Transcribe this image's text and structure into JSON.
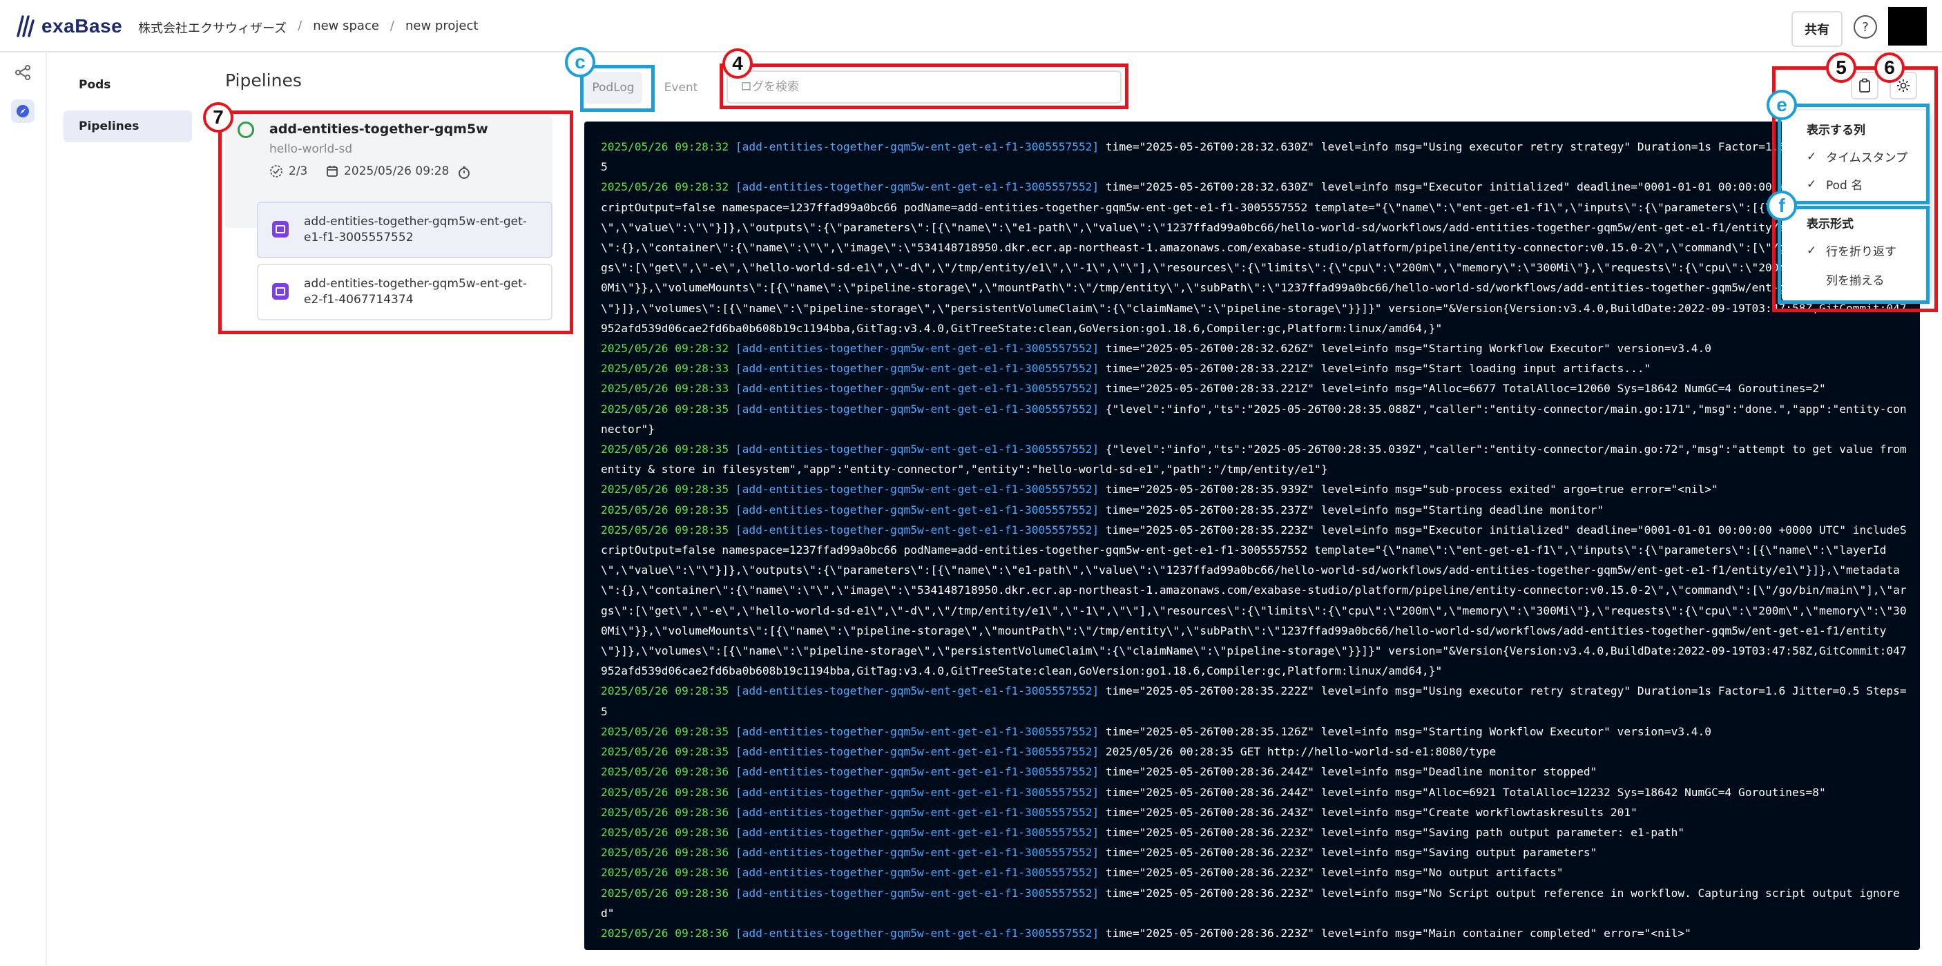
{
  "header": {
    "brand": "exaBase",
    "breadcrumbs": [
      "株式会社エクサウィザーズ",
      "new space",
      "new project"
    ],
    "separator": "/",
    "share_label": "共有",
    "help_symbol": "?"
  },
  "nav": {
    "items": [
      {
        "label": "Pods",
        "active": false
      },
      {
        "label": "Pipelines",
        "active": true
      }
    ]
  },
  "pipelines": {
    "title": "Pipelines",
    "card": {
      "name": "add-entities-together-gqm5w",
      "subtitle": "hello-world-sd",
      "progress": "2/3",
      "date": "2025/05/26 09:28",
      "status": "running"
    },
    "sub_items": [
      "add-entities-together-gqm5w-ent-get-e1-f1-3005557552",
      "add-entities-together-gqm5w-ent-get-e2-f1-4067714374"
    ]
  },
  "log_view": {
    "tabs": [
      {
        "label": "PodLog",
        "active": true
      },
      {
        "label": "Event",
        "active": false
      }
    ],
    "search_placeholder": "ログを検索",
    "lines": [
      {
        "ts": "2025/05/26 09:28:32",
        "pod": "[add-entities-together-gqm5w-ent-get-e1-f1-3005557552]",
        "msg": " time=\"2025-05-26T00:28:32.630Z\" level=info msg=\"Using executor retry strategy\" Duration=1s Factor=1.6 Jitter=0.5 Steps=5"
      },
      {
        "ts": "2025/05/26 09:28:32",
        "pod": "[add-entities-together-gqm5w-ent-get-e1-f1-3005557552]",
        "msg": " time=\"2025-05-26T00:28:32.630Z\" level=info msg=\"Executor initialized\" deadline=\"0001-01-01 00:00:00 +0000 UTC\" includeScriptOutput=false namespace=1237ffad99a0bc66 podName=add-entities-together-gqm5w-ent-get-e1-f1-3005557552 template=\"{\\\"name\\\":\\\"ent-get-e1-f1\\\",\\\"inputs\\\":{\\\"parameters\\\":[{\\\"name\\\":\\\"layerId\\\",\\\"value\\\":\\\"\\\"}]},\\\"outputs\\\":{\\\"parameters\\\":[{\\\"name\\\":\\\"e1-path\\\",\\\"value\\\":\\\"1237ffad99a0bc66/hello-world-sd/workflows/add-entities-together-gqm5w/ent-get-e1-f1/entity/e1\\\"}]},\\\"metadata\\\":{},\\\"container\\\":{\\\"name\\\":\\\"\\\",\\\"image\\\":\\\"534148718950.dkr.ecr.ap-northeast-1.amazonaws.com/exabase-studio/platform/pipeline/entity-connector:v0.15.0-2\\\",\\\"command\\\":[\\\"/go/bin/main\\\"],\\\"args\\\":[\\\"get\\\",\\\"-e\\\",\\\"hello-world-sd-e1\\\",\\\"-d\\\",\\\"/tmp/entity/e1\\\",\\\"-1\\\",\\\"\\\"],\\\"resources\\\":{\\\"limits\\\":{\\\"cpu\\\":\\\"200m\\\",\\\"memory\\\":\\\"300Mi\\\"},\\\"requests\\\":{\\\"cpu\\\":\\\"200m\\\",\\\"memory\\\":\\\"300Mi\\\"}},\\\"volumeMounts\\\":[{\\\"name\\\":\\\"pipeline-storage\\\",\\\"mountPath\\\":\\\"/tmp/entity\\\",\\\"subPath\\\":\\\"1237ffad99a0bc66/hello-world-sd/workflows/add-entities-together-gqm5w/ent-get-e1-f1/entity\\\"}]},\\\"volumes\\\":[{\\\"name\\\":\\\"pipeline-storage\\\",\\\"persistentVolumeClaim\\\":{\\\"claimName\\\":\\\"pipeline-storage\\\"}}]}\" version=\"&Version{Version:v3.4.0,BuildDate:2022-09-19T03:47:58Z,GitCommit:047952afd539d06cae2fd6ba0b608b19c1194bba,GitTag:v3.4.0,GitTreeState:clean,GoVersion:go1.18.6,Compiler:gc,Platform:linux/amd64,}\""
      },
      {
        "ts": "2025/05/26 09:28:32",
        "pod": "[add-entities-together-gqm5w-ent-get-e1-f1-3005557552]",
        "msg": " time=\"2025-05-26T00:28:32.626Z\" level=info msg=\"Starting Workflow Executor\" version=v3.4.0"
      },
      {
        "ts": "2025/05/26 09:28:33",
        "pod": "[add-entities-together-gqm5w-ent-get-e1-f1-3005557552]",
        "msg": " time=\"2025-05-26T00:28:33.221Z\" level=info msg=\"Start loading input artifacts...\""
      },
      {
        "ts": "2025/05/26 09:28:33",
        "pod": "[add-entities-together-gqm5w-ent-get-e1-f1-3005557552]",
        "msg": " time=\"2025-05-26T00:28:33.221Z\" level=info msg=\"Alloc=6677 TotalAlloc=12060 Sys=18642 NumGC=4 Goroutines=2\""
      },
      {
        "ts": "2025/05/26 09:28:35",
        "pod": "[add-entities-together-gqm5w-ent-get-e1-f1-3005557552]",
        "msg": " {\"level\":\"info\",\"ts\":\"2025-05-26T00:28:35.088Z\",\"caller\":\"entity-connector/main.go:171\",\"msg\":\"done.\",\"app\":\"entity-connector\"}"
      },
      {
        "ts": "2025/05/26 09:28:35",
        "pod": "[add-entities-together-gqm5w-ent-get-e1-f1-3005557552]",
        "msg": " {\"level\":\"info\",\"ts\":\"2025-05-26T00:28:35.039Z\",\"caller\":\"entity-connector/main.go:72\",\"msg\":\"attempt to get value from entity & store in filesystem\",\"app\":\"entity-connector\",\"entity\":\"hello-world-sd-e1\",\"path\":\"/tmp/entity/e1\"}"
      },
      {
        "ts": "2025/05/26 09:28:35",
        "pod": "[add-entities-together-gqm5w-ent-get-e1-f1-3005557552]",
        "msg": " time=\"2025-05-26T00:28:35.939Z\" level=info msg=\"sub-process exited\" argo=true error=\"<nil>\""
      },
      {
        "ts": "2025/05/26 09:28:35",
        "pod": "[add-entities-together-gqm5w-ent-get-e1-f1-3005557552]",
        "msg": " time=\"2025-05-26T00:28:35.237Z\" level=info msg=\"Starting deadline monitor\""
      },
      {
        "ts": "2025/05/26 09:28:35",
        "pod": "[add-entities-together-gqm5w-ent-get-e1-f1-3005557552]",
        "msg": " time=\"2025-05-26T00:28:35.223Z\" level=info msg=\"Executor initialized\" deadline=\"0001-01-01 00:00:00 +0000 UTC\" includeScriptOutput=false namespace=1237ffad99a0bc66 podName=add-entities-together-gqm5w-ent-get-e1-f1-3005557552 template=\"{\\\"name\\\":\\\"ent-get-e1-f1\\\",\\\"inputs\\\":{\\\"parameters\\\":[{\\\"name\\\":\\\"layerId\\\",\\\"value\\\":\\\"\\\"}]},\\\"outputs\\\":{\\\"parameters\\\":[{\\\"name\\\":\\\"e1-path\\\",\\\"value\\\":\\\"1237ffad99a0bc66/hello-world-sd/workflows/add-entities-together-gqm5w/ent-get-e1-f1/entity/e1\\\"}]},\\\"metadata\\\":{},\\\"container\\\":{\\\"name\\\":\\\"\\\",\\\"image\\\":\\\"534148718950.dkr.ecr.ap-northeast-1.amazonaws.com/exabase-studio/platform/pipeline/entity-connector:v0.15.0-2\\\",\\\"command\\\":[\\\"/go/bin/main\\\"],\\\"args\\\":[\\\"get\\\",\\\"-e\\\",\\\"hello-world-sd-e1\\\",\\\"-d\\\",\\\"/tmp/entity/e1\\\",\\\"-1\\\",\\\"\\\"],\\\"resources\\\":{\\\"limits\\\":{\\\"cpu\\\":\\\"200m\\\",\\\"memory\\\":\\\"300Mi\\\"},\\\"requests\\\":{\\\"cpu\\\":\\\"200m\\\",\\\"memory\\\":\\\"300Mi\\\"}},\\\"volumeMounts\\\":[{\\\"name\\\":\\\"pipeline-storage\\\",\\\"mountPath\\\":\\\"/tmp/entity\\\",\\\"subPath\\\":\\\"1237ffad99a0bc66/hello-world-sd/workflows/add-entities-together-gqm5w/ent-get-e1-f1/entity\\\"}]},\\\"volumes\\\":[{\\\"name\\\":\\\"pipeline-storage\\\",\\\"persistentVolumeClaim\\\":{\\\"claimName\\\":\\\"pipeline-storage\\\"}}]}\" version=\"&Version{Version:v3.4.0,BuildDate:2022-09-19T03:47:58Z,GitCommit:047952afd539d06cae2fd6ba0b608b19c1194bba,GitTag:v3.4.0,GitTreeState:clean,GoVersion:go1.18.6,Compiler:gc,Platform:linux/amd64,}\""
      },
      {
        "ts": "2025/05/26 09:28:35",
        "pod": "[add-entities-together-gqm5w-ent-get-e1-f1-3005557552]",
        "msg": " time=\"2025-05-26T00:28:35.222Z\" level=info msg=\"Using executor retry strategy\" Duration=1s Factor=1.6 Jitter=0.5 Steps=5"
      },
      {
        "ts": "2025/05/26 09:28:35",
        "pod": "[add-entities-together-gqm5w-ent-get-e1-f1-3005557552]",
        "msg": " time=\"2025-05-26T00:28:35.126Z\" level=info msg=\"Starting Workflow Executor\" version=v3.4.0"
      },
      {
        "ts": "2025/05/26 09:28:35",
        "pod": "[add-entities-together-gqm5w-ent-get-e1-f1-3005557552]",
        "msg": " 2025/05/26 00:28:35 GET http://hello-world-sd-e1:8080/type"
      },
      {
        "ts": "2025/05/26 09:28:36",
        "pod": "[add-entities-together-gqm5w-ent-get-e1-f1-3005557552]",
        "msg": " time=\"2025-05-26T00:28:36.244Z\" level=info msg=\"Deadline monitor stopped\""
      },
      {
        "ts": "2025/05/26 09:28:36",
        "pod": "[add-entities-together-gqm5w-ent-get-e1-f1-3005557552]",
        "msg": " time=\"2025-05-26T00:28:36.244Z\" level=info msg=\"Alloc=6921 TotalAlloc=12232 Sys=18642 NumGC=4 Goroutines=8\""
      },
      {
        "ts": "2025/05/26 09:28:36",
        "pod": "[add-entities-together-gqm5w-ent-get-e1-f1-3005557552]",
        "msg": " time=\"2025-05-26T00:28:36.243Z\" level=info msg=\"Create workflowtaskresults 201\""
      },
      {
        "ts": "2025/05/26 09:28:36",
        "pod": "[add-entities-together-gqm5w-ent-get-e1-f1-3005557552]",
        "msg": " time=\"2025-05-26T00:28:36.223Z\" level=info msg=\"Saving path output parameter: e1-path\""
      },
      {
        "ts": "2025/05/26 09:28:36",
        "pod": "[add-entities-together-gqm5w-ent-get-e1-f1-3005557552]",
        "msg": " time=\"2025-05-26T00:28:36.223Z\" level=info msg=\"Saving output parameters\""
      },
      {
        "ts": "2025/05/26 09:28:36",
        "pod": "[add-entities-together-gqm5w-ent-get-e1-f1-3005557552]",
        "msg": " time=\"2025-05-26T00:28:36.223Z\" level=info msg=\"No output artifacts\""
      },
      {
        "ts": "2025/05/26 09:28:36",
        "pod": "[add-entities-together-gqm5w-ent-get-e1-f1-3005557552]",
        "msg": " time=\"2025-05-26T00:28:36.223Z\" level=info msg=\"No Script output reference in workflow. Capturing script output ignored\""
      },
      {
        "ts": "2025/05/26 09:28:36",
        "pod": "[add-entities-together-gqm5w-ent-get-e1-f1-3005557552]",
        "msg": " time=\"2025-05-26T00:28:36.223Z\" level=info msg=\"Main container completed\" error=\"<nil>\""
      }
    ]
  },
  "column_menu": {
    "columns_header": "表示する列",
    "columns": [
      {
        "label": "タイムスタンプ",
        "checked": true
      },
      {
        "label": "Pod 名",
        "checked": true
      }
    ],
    "format_header": "表示形式",
    "formats": [
      {
        "label": "行を折り返す",
        "checked": true
      },
      {
        "label": "列を揃える",
        "checked": false
      }
    ],
    "check_mark": "✓"
  },
  "annotations": {
    "c": "c",
    "e": "e",
    "f": "f",
    "n4": "4",
    "n5": "5",
    "n6": "6",
    "n7": "7"
  },
  "colors": {
    "accent": "#1d2a6b",
    "log_bg": "#000b1a",
    "log_timestamp": "#5fe34a",
    "log_pod": "#4aa8ff",
    "annotation_red": "#e8141b",
    "annotation_blue": "#1a9fd8",
    "pod_icon": "#7b3fe4",
    "status_running": "#2ea043"
  }
}
